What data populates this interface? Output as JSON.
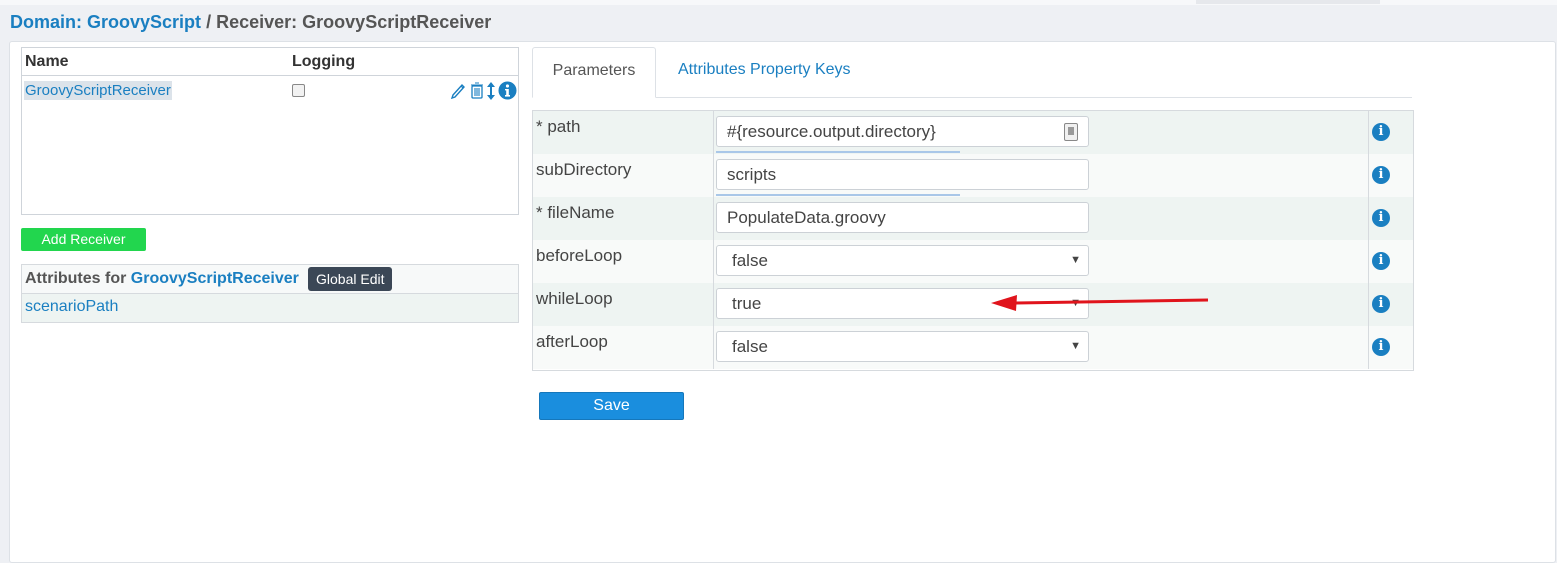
{
  "breadcrumb": {
    "domain_label": "Domain:",
    "domain_name": "GroovyScript",
    "separator": "/",
    "receiver_label": "Receiver:",
    "receiver_name": "GroovyScriptReceiver"
  },
  "receivers_table": {
    "col_name": "Name",
    "col_logging": "Logging",
    "rows": [
      {
        "name": "GroovyScriptReceiver",
        "logging": false
      }
    ]
  },
  "buttons": {
    "add_receiver": "Add Receiver",
    "global_edit": "Global Edit",
    "save": "Save"
  },
  "attributes_panel": {
    "title_prefix": "Attributes for",
    "receiver_name": "GroovyScriptReceiver",
    "items": [
      "scenarioPath"
    ]
  },
  "tabs": {
    "parameters": "Parameters",
    "property_keys": "Attributes Property Keys"
  },
  "params": [
    {
      "label": "* path",
      "value": "#{resource.output.directory}",
      "kind": "text"
    },
    {
      "label": "subDirectory",
      "value": "scripts",
      "kind": "text"
    },
    {
      "label": "* fileName",
      "value": "PopulateData.groovy",
      "kind": "text"
    },
    {
      "label": "beforeLoop",
      "value": "false",
      "kind": "select"
    },
    {
      "label": "whileLoop",
      "value": "true",
      "kind": "select"
    },
    {
      "label": "afterLoop",
      "value": "false",
      "kind": "select"
    }
  ],
  "colors": {
    "link": "#1a7fc1",
    "add_button": "#22d64e",
    "save_button": "#1a8ede",
    "annotation_arrow": "#e0141c"
  },
  "icons": [
    "edit-icon",
    "trash-icon",
    "sort-icon",
    "info-icon",
    "notes-icon",
    "caret-down-icon"
  ]
}
